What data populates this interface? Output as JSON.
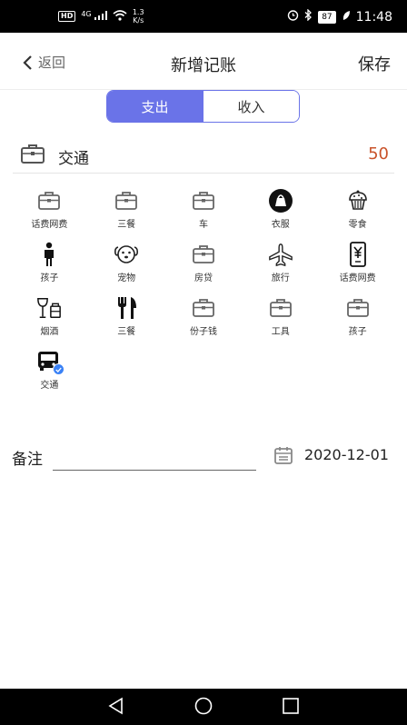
{
  "status_bar": {
    "hd": "HD",
    "network": "4G",
    "speed_value": "1.3",
    "speed_unit": "K/s",
    "battery": "87",
    "time": "11:48"
  },
  "header": {
    "back_label": "返回",
    "title": "新增记账",
    "save_label": "保存"
  },
  "type_toggle": {
    "expense_label": "支出",
    "income_label": "收入",
    "selected": "expense"
  },
  "selected_category": {
    "name": "交通",
    "amount": "50",
    "icon": "briefcase-icon"
  },
  "categories": [
    {
      "label": "话费网费",
      "icon": "briefcase-icon"
    },
    {
      "label": "三餐",
      "icon": "briefcase-icon"
    },
    {
      "label": "车",
      "icon": "briefcase-icon"
    },
    {
      "label": "衣服",
      "icon": "bag-icon"
    },
    {
      "label": "零食",
      "icon": "cupcake-icon"
    },
    {
      "label": "孩子",
      "icon": "child-icon"
    },
    {
      "label": "宠物",
      "icon": "dog-icon"
    },
    {
      "label": "房贷",
      "icon": "briefcase-icon"
    },
    {
      "label": "旅行",
      "icon": "airplane-icon"
    },
    {
      "label": "话费网费",
      "icon": "phone-bill-icon"
    },
    {
      "label": "烟酒",
      "icon": "wine-icon"
    },
    {
      "label": "三餐",
      "icon": "utensils-icon"
    },
    {
      "label": "份子钱",
      "icon": "briefcase-icon"
    },
    {
      "label": "工具",
      "icon": "briefcase-icon"
    },
    {
      "label": "孩子",
      "icon": "briefcase-icon"
    },
    {
      "label": "交通",
      "icon": "bus-icon",
      "selected": true
    }
  ],
  "remark": {
    "label": "备注",
    "value": ""
  },
  "date": {
    "value": "2020-12-01"
  },
  "colors": {
    "accent": "#6a73e8",
    "amount": "#c9532a",
    "check": "#3b82f6"
  }
}
